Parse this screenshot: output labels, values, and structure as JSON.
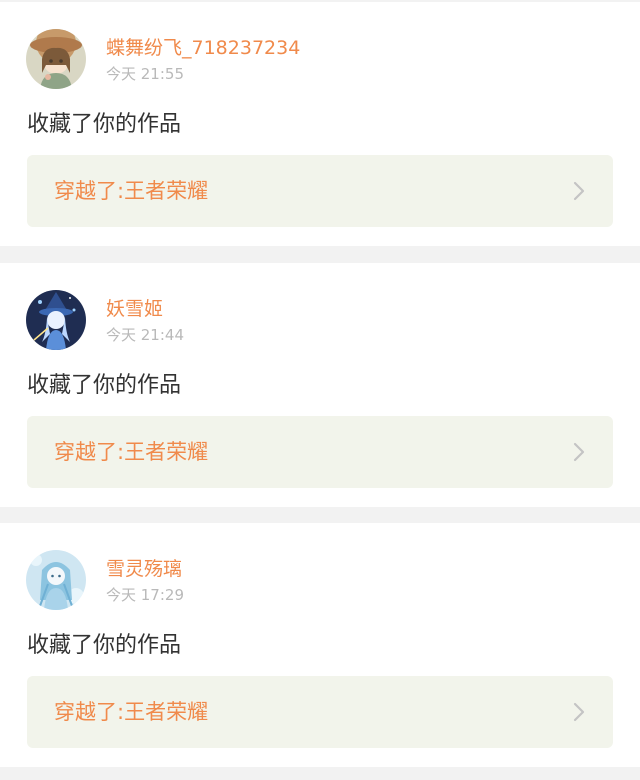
{
  "notifications": [
    {
      "username": "蝶舞纷飞_718237234",
      "time": "今天 21:55",
      "action": "收藏了你的作品",
      "work_title": "穿越了:王者荣耀",
      "avatar_icon": "avatar-girl-hat-icon"
    },
    {
      "username": "妖雪姬",
      "time": "今天 21:44",
      "action": "收藏了你的作品",
      "work_title": "穿越了:王者荣耀",
      "avatar_icon": "avatar-blue-mage-icon"
    },
    {
      "username": "雪灵殇璃",
      "time": "今天 17:29",
      "action": "收藏了你的作品",
      "work_title": "穿越了:王者荣耀",
      "avatar_icon": "avatar-ice-girl-icon"
    }
  ],
  "colors": {
    "accent": "#f08a4b",
    "card_bg": "#ffffff",
    "page_bg": "#f2f2f2",
    "link_bg": "#f2f4eb",
    "time_text": "#b9b9b9",
    "body_text": "#333333"
  }
}
